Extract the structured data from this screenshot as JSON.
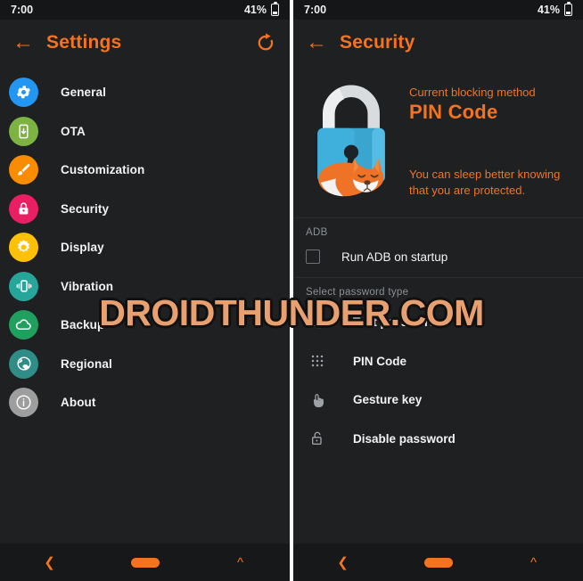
{
  "status_bar": {
    "time": "7:00",
    "battery_percent": "41%",
    "battery_icon": "battery-icon"
  },
  "left_panel": {
    "appbar": {
      "back_icon": "back-arrow-icon",
      "title": "Settings",
      "restore_icon": "restore-icon"
    },
    "menu": [
      {
        "label": "General",
        "icon": "gear-icon",
        "color": "#2196f3"
      },
      {
        "label": "OTA",
        "icon": "phone-download-icon",
        "color": "#7cb342"
      },
      {
        "label": "Customization",
        "icon": "brush-icon",
        "color": "#fb8c00"
      },
      {
        "label": "Security",
        "icon": "lock-icon",
        "color": "#e91e63"
      },
      {
        "label": "Display",
        "icon": "sun-icon",
        "color": "#ffc107"
      },
      {
        "label": "Vibration",
        "icon": "vibrate-icon",
        "color": "#26a69a"
      },
      {
        "label": "Backup",
        "icon": "cloud-icon",
        "color": "#1fa05e"
      },
      {
        "label": "Regional",
        "icon": "globe-icon",
        "color": "#2f8c87"
      },
      {
        "label": "About",
        "icon": "info-icon",
        "color": "#9e9e9e"
      }
    ]
  },
  "right_panel": {
    "appbar": {
      "back_icon": "back-arrow-icon",
      "title": "Security"
    },
    "hero": {
      "illustration": "padlock-with-sleeping-fox-illustration",
      "caption": "Current blocking method",
      "value": "PIN Code",
      "note": "You can sleep better knowing that you are protected."
    },
    "adb_section": {
      "header": "ADB",
      "checkbox_label": "Run ADB on startup",
      "checkbox_checked": false
    },
    "password_section": {
      "header": "Select password type",
      "options": [
        {
          "label": "Text password",
          "icon": "keyboard-icon"
        },
        {
          "label": "PIN Code",
          "icon": "dot-grid-icon"
        },
        {
          "label": "Gesture key",
          "icon": "touch-hand-icon"
        },
        {
          "label": "Disable password",
          "icon": "unlock-icon"
        }
      ]
    }
  },
  "nav_bar": {
    "back_icon": "nav-back-icon",
    "home_icon": "nav-home-pill",
    "recents_icon": "nav-up-icon"
  },
  "watermark": {
    "text": "DROIDTHUNDER.COM"
  },
  "colors": {
    "accent": "#f4731f",
    "background": "#1e2022",
    "status_bg": "#141618",
    "watermark": "#e8a070"
  }
}
